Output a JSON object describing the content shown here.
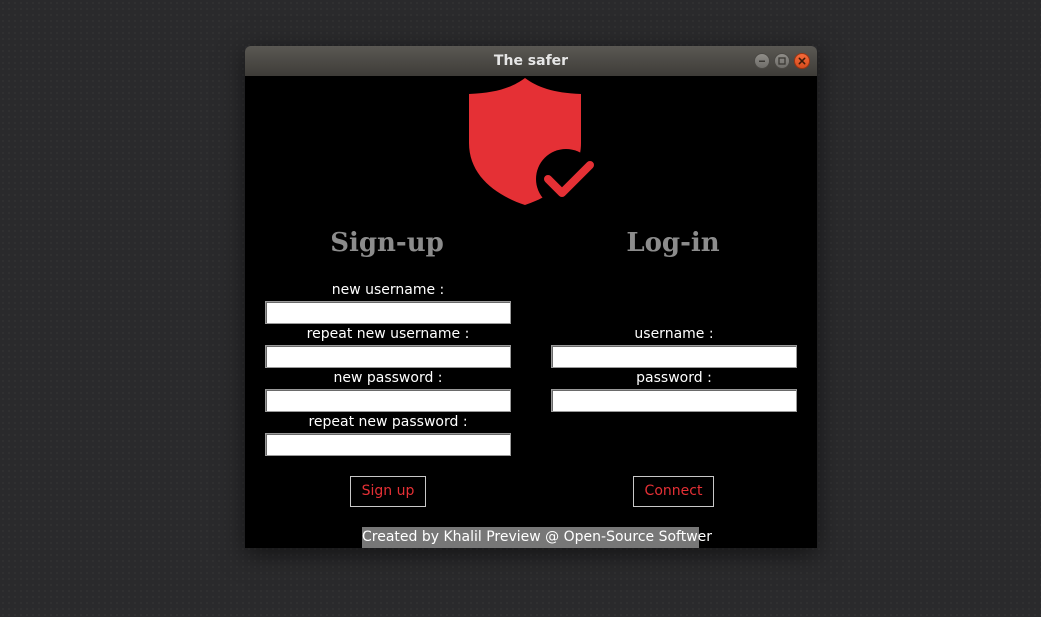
{
  "window": {
    "title": "The safer"
  },
  "logo": {
    "icon": "shield-check-icon",
    "color": "#e53035"
  },
  "signup": {
    "heading": "Sign-up",
    "fields": [
      {
        "label": "new username :",
        "value": ""
      },
      {
        "label": "repeat new username :",
        "value": ""
      },
      {
        "label": "new password :",
        "value": ""
      },
      {
        "label": "repeat new password :",
        "value": ""
      }
    ],
    "button_label": "Sign up"
  },
  "login": {
    "heading": "Log-in",
    "fields": [
      {
        "label": "username :",
        "value": ""
      },
      {
        "label": "password :",
        "value": ""
      }
    ],
    "button_label": "Connect"
  },
  "footer": {
    "text": "Created by  Khalil Preview @ Open-Source Softwer"
  },
  "colors": {
    "accent": "#e53035",
    "heading": "#8c8c8c",
    "background": "#000000",
    "footer_bg": "#777777"
  }
}
